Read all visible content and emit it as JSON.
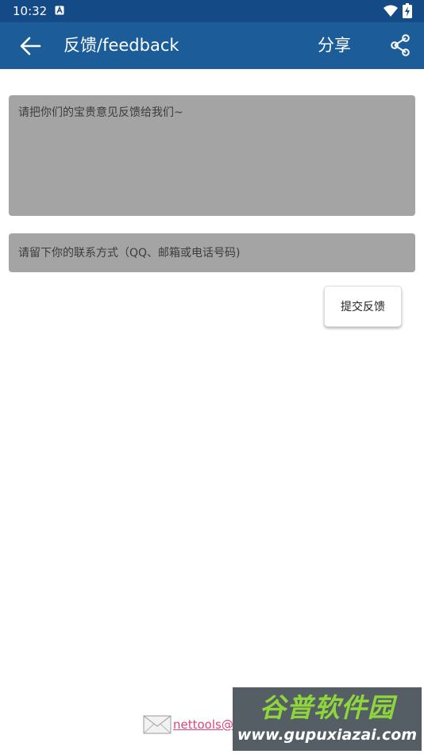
{
  "status_bar": {
    "time": "10:32",
    "icons": [
      "notification-a-icon",
      "wifi-icon",
      "battery-charging-icon"
    ],
    "color": "#144a86"
  },
  "toolbar": {
    "title": "反馈/feedback",
    "share_label": "分享",
    "back_icon": "arrow-left-icon",
    "share_icon": "share-icon",
    "color": "#1c5c98"
  },
  "form": {
    "feedback_placeholder": "请把你们的宝贵意见反馈给我们~",
    "feedback_value": "",
    "contact_placeholder": "请留下你的联系方式（QQ、邮箱或电话号码)",
    "contact_value": "",
    "submit_label": "提交反馈",
    "field_color": "#a4a4a4"
  },
  "footer": {
    "email_icon": "envelope-icon",
    "email_text": "nettools@",
    "link_color": "#e0437a"
  },
  "watermark": {
    "logo_text": "谷普软件园",
    "url": "www.gupuxiazai.com"
  }
}
